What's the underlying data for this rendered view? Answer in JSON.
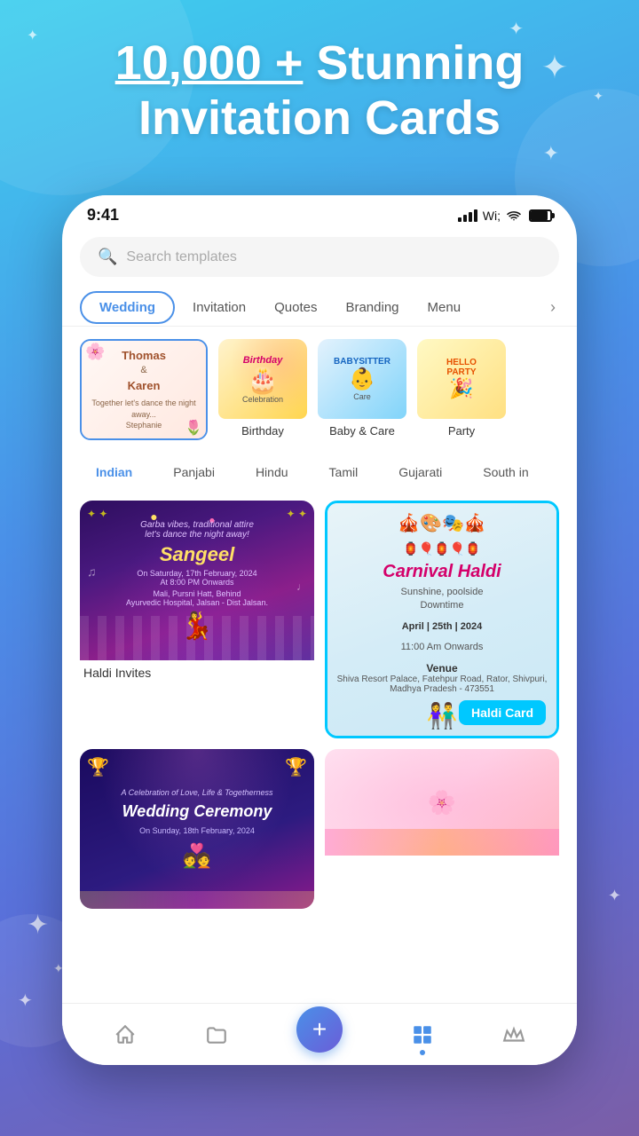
{
  "hero": {
    "title_line1": "10,000 + Stunning",
    "title_line2": "Invitation Cards",
    "title_highlight": "10,000 +"
  },
  "status_bar": {
    "time": "9:41"
  },
  "search": {
    "placeholder": "Search templates"
  },
  "tabs": {
    "items": [
      {
        "label": "Wedding",
        "active": true
      },
      {
        "label": "Invitation",
        "active": false
      },
      {
        "label": "Quotes",
        "active": false
      },
      {
        "label": "Branding",
        "active": false
      },
      {
        "label": "Menu",
        "active": false
      }
    ]
  },
  "template_categories": [
    {
      "label": "Wedding",
      "selected": true,
      "emoji": "💐"
    },
    {
      "label": "Birthday",
      "selected": false,
      "emoji": "🎂"
    },
    {
      "label": "Baby & Care",
      "selected": false,
      "emoji": "🍼"
    },
    {
      "label": "Party",
      "selected": false,
      "emoji": "🎉"
    }
  ],
  "filter_chips": [
    {
      "label": "Indian",
      "active": true
    },
    {
      "label": "Panjabi",
      "active": false
    },
    {
      "label": "Hindu",
      "active": false
    },
    {
      "label": "Tamil",
      "active": false
    },
    {
      "label": "Gujarati",
      "active": false
    },
    {
      "label": "South in",
      "active": false
    }
  ],
  "cards": [
    {
      "id": "haldi-invites",
      "label": "Haldi Invites",
      "highlighted": false,
      "badge": null
    },
    {
      "id": "carnival-haldi",
      "label": "",
      "highlighted": true,
      "badge": "Haldi Card"
    },
    {
      "id": "wedding-ceremony",
      "label": "",
      "highlighted": false,
      "badge": null
    },
    {
      "id": "card-4",
      "label": "",
      "highlighted": false,
      "badge": null
    }
  ],
  "carnival_card": {
    "title": "Carnival Haldi",
    "subtitle1": "Sunshine, poolside",
    "subtitle2": "Downtime",
    "date": "April | 25th | 2024",
    "time": "11:00 Am Onwards",
    "venue_label": "Venue",
    "venue_detail": "Shiva Resort Palace, Fatehpur Road,\nRator, Shivpuri, Madhya Pradesh - 473551"
  },
  "haldi_card": {
    "title": "Sangeel",
    "subtitle": "Garba vibes, traditional attire\nlet's dance the night away!"
  },
  "wedding_ceremony_card": {
    "small": "A Celebration of Love, Life & Togetherness",
    "title": "Wedding Ceremony",
    "date": "On Sunday, 18th February, 2024"
  },
  "bottom_nav": {
    "items": [
      {
        "icon": "🏠",
        "label": "home",
        "active": false
      },
      {
        "icon": "📁",
        "label": "folder",
        "active": false
      },
      {
        "icon": "⊞",
        "label": "grid",
        "active": true
      },
      {
        "icon": "👑",
        "label": "crown",
        "active": false
      }
    ]
  },
  "fab": {
    "label": "+"
  }
}
